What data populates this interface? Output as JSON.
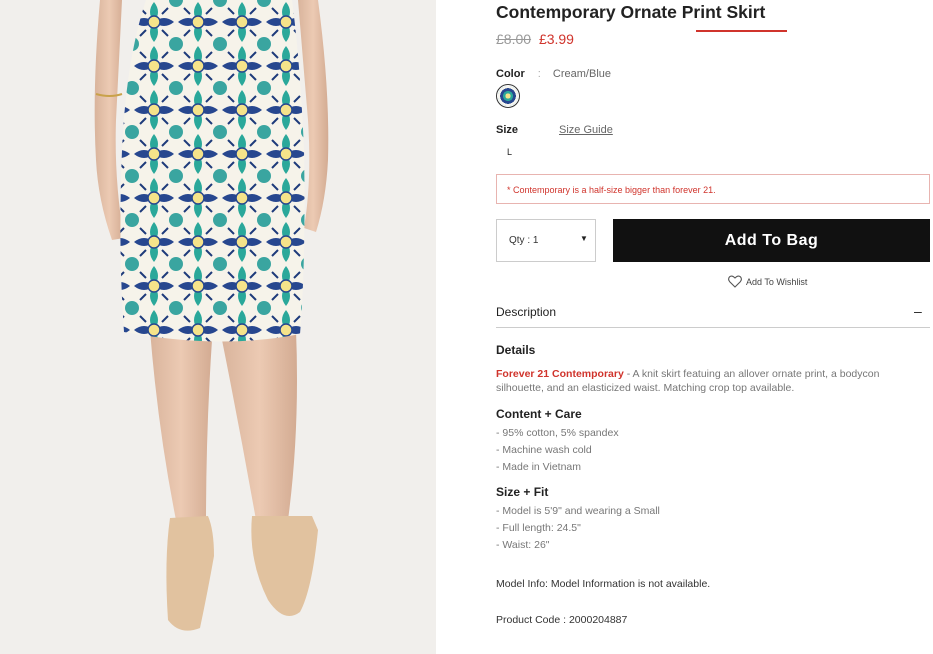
{
  "product": {
    "title": "Contemporary Ornate Print Skirt",
    "price_old": "£8.00",
    "price_new": "£3.99"
  },
  "color": {
    "label": "Color",
    "separator": ":",
    "value": "Cream/Blue"
  },
  "size": {
    "label": "Size",
    "guide_link": "Size Guide",
    "selected": "L"
  },
  "note": "* Contemporary is a half-size bigger than forever 21.",
  "qty": {
    "label": "Qty : 1"
  },
  "actions": {
    "add_to_bag": "Add To Bag",
    "wishlist": "Add To Wishlist"
  },
  "description": {
    "heading": "Description",
    "toggle": "–"
  },
  "details": {
    "heading": "Details",
    "brand": "Forever 21 Contemporary",
    "text": " - A knit skirt featuing an allover ornate print, a bodycon silhouette, and an elasticized waist. Matching crop top available."
  },
  "content_care": {
    "heading": "Content + Care",
    "items": [
      "- 95% cotton, 5% spandex",
      "- Machine wash cold",
      "- Made in Vietnam"
    ]
  },
  "size_fit": {
    "heading": "Size + Fit",
    "items": [
      "- Model is 5'9\" and wearing a Small",
      "- Full length: 24.5\"",
      "- Waist: 26\""
    ]
  },
  "model_info": "Model Info: Model Information is not available.",
  "product_code": "Product Code : 2000204887",
  "colors": {
    "accent_red": "#d0342c",
    "button_black": "#111111",
    "print_teal": "#2aa89a",
    "print_navy": "#27478f",
    "print_yellow": "#f5e38a"
  }
}
